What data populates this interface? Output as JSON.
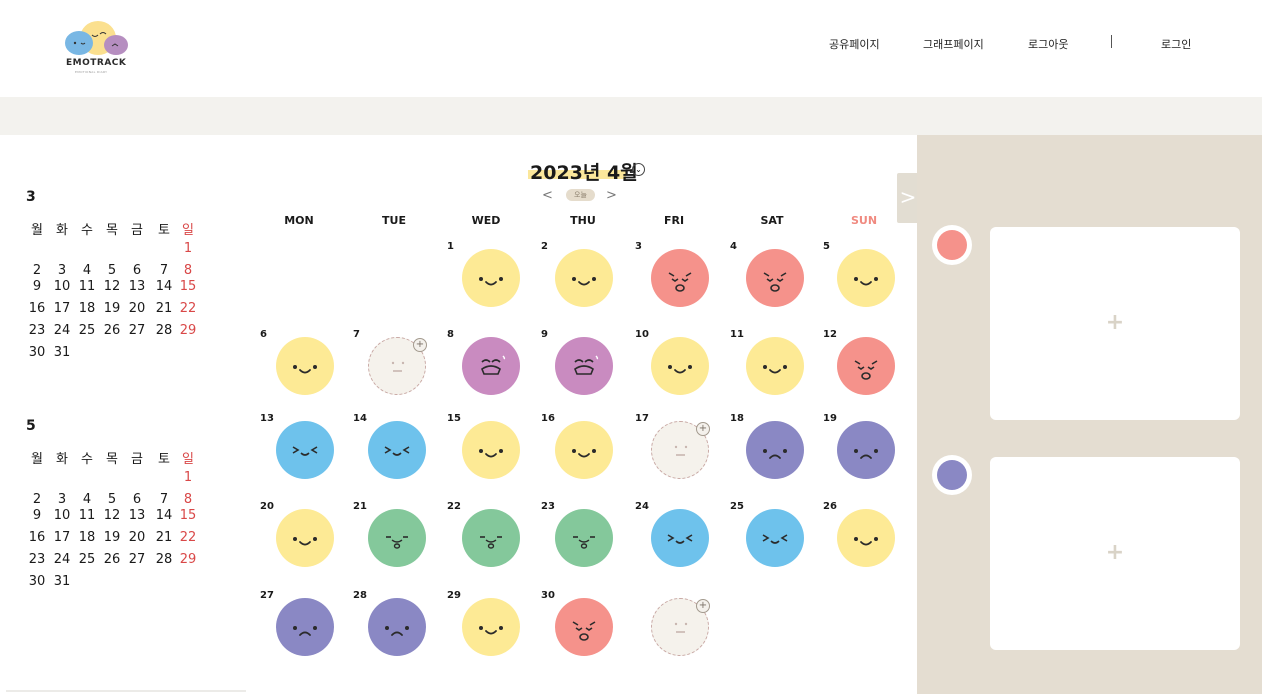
{
  "header": {
    "logo_text": "EMOTRACK",
    "logo_sub": "EMOTIONAL DIARY",
    "nav": [
      "공유페이지",
      "그래프페이지",
      "로그아웃",
      "로그인"
    ]
  },
  "mini_calendars": [
    {
      "month": "3",
      "weekdays": [
        "월",
        "화",
        "수",
        "목",
        "금",
        "토",
        "일"
      ],
      "weeks": [
        [
          "",
          "",
          "",
          "",
          "",
          "",
          "1"
        ],
        [
          "2",
          "3",
          "4",
          "5",
          "6",
          "7",
          "8"
        ],
        [
          "9",
          "10",
          "11",
          "12",
          "13",
          "14",
          "15"
        ],
        [
          "16",
          "17",
          "18",
          "19",
          "20",
          "21",
          "22"
        ],
        [
          "23",
          "24",
          "25",
          "26",
          "27",
          "28",
          "29"
        ],
        [
          "30",
          "31",
          "",
          "",
          "",
          "",
          ""
        ]
      ]
    },
    {
      "month": "5",
      "weekdays": [
        "월",
        "화",
        "수",
        "목",
        "금",
        "토",
        "일"
      ],
      "weeks": [
        [
          "",
          "",
          "",
          "",
          "",
          "",
          "1"
        ],
        [
          "2",
          "3",
          "4",
          "5",
          "6",
          "7",
          "8"
        ],
        [
          "9",
          "10",
          "11",
          "12",
          "13",
          "14",
          "15"
        ],
        [
          "16",
          "17",
          "18",
          "19",
          "20",
          "21",
          "22"
        ],
        [
          "23",
          "24",
          "25",
          "26",
          "27",
          "28",
          "29"
        ],
        [
          "30",
          "31",
          "",
          "",
          "",
          "",
          ""
        ]
      ]
    }
  ],
  "calendar": {
    "title": "2023년 4월",
    "today_label": "오늘",
    "prev_icon": "<",
    "next_icon": ">",
    "weekdays": [
      "MON",
      "TUE",
      "WED",
      "THU",
      "FRI",
      "SAT",
      "SUN"
    ],
    "colors": {
      "happy": "#fdea95",
      "angry": "#f5928b",
      "sad": "#c98bc0",
      "excited": "#6ec2ec",
      "tired": "#84c89b",
      "gloomy": "#8a88c4",
      "none": "#f5f2ec",
      "sunday": "#f08a80"
    },
    "weeks": [
      [
        null,
        null,
        {
          "d": "1",
          "m": "happy"
        },
        {
          "d": "2",
          "m": "happy"
        },
        {
          "d": "3",
          "m": "angry"
        },
        {
          "d": "4",
          "m": "angry"
        },
        {
          "d": "5",
          "m": "happy"
        }
      ],
      [
        {
          "d": "6",
          "m": "happy"
        },
        {
          "d": "7",
          "m": "none"
        },
        {
          "d": "8",
          "m": "sad"
        },
        {
          "d": "9",
          "m": "sad"
        },
        {
          "d": "10",
          "m": "happy"
        },
        {
          "d": "11",
          "m": "happy"
        },
        {
          "d": "12",
          "m": "angry"
        }
      ],
      [
        {
          "d": "13",
          "m": "excited"
        },
        {
          "d": "14",
          "m": "excited"
        },
        {
          "d": "15",
          "m": "happy"
        },
        {
          "d": "16",
          "m": "happy"
        },
        {
          "d": "17",
          "m": "none"
        },
        {
          "d": "18",
          "m": "gloomy"
        },
        {
          "d": "19",
          "m": "gloomy"
        }
      ],
      [
        {
          "d": "20",
          "m": "happy"
        },
        {
          "d": "21",
          "m": "tired"
        },
        {
          "d": "22",
          "m": "tired"
        },
        {
          "d": "23",
          "m": "tired"
        },
        {
          "d": "24",
          "m": "excited"
        },
        {
          "d": "25",
          "m": "excited"
        },
        {
          "d": "26",
          "m": "happy"
        }
      ],
      [
        {
          "d": "27",
          "m": "gloomy"
        },
        {
          "d": "28",
          "m": "gloomy"
        },
        {
          "d": "29",
          "m": "happy"
        },
        {
          "d": "30",
          "m": "angry"
        },
        {
          "d": "",
          "m": "none"
        },
        null,
        null
      ]
    ]
  },
  "side_panel": {
    "toggle_icon": ">",
    "entries": [
      {
        "color": "#f5928b",
        "plus": "+"
      },
      {
        "color": "#8a88c4",
        "plus": "+"
      }
    ]
  }
}
